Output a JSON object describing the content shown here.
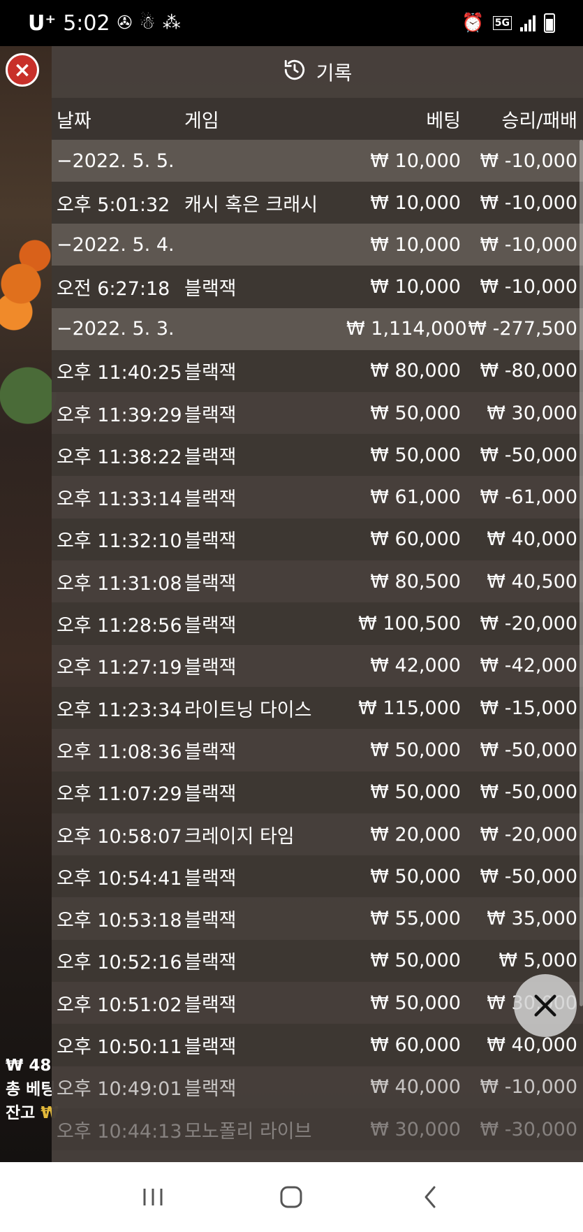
{
  "status_bar": {
    "carrier": "U⁺",
    "time": "5:02",
    "network": "5G"
  },
  "background": {
    "balance_line": "₩ 48",
    "total_bet_line": "총 베팅",
    "remain_line": "잔고 ",
    "remain_value": "₩"
  },
  "panel": {
    "title": "기록",
    "columns": {
      "date": "날짜",
      "game": "게임",
      "bet": "베팅",
      "winloss": "승리/패배"
    }
  },
  "rows": [
    {
      "type": "group",
      "date": "−2022. 5. 5.",
      "game": "",
      "bet": "₩ 10,000",
      "winloss": "₩ -10,000"
    },
    {
      "type": "item",
      "date": "오후 5:01:32",
      "game": "캐시 혹은 크래시",
      "bet": "₩ 10,000",
      "winloss": "₩ -10,000"
    },
    {
      "type": "group",
      "date": "−2022. 5. 4.",
      "game": "",
      "bet": "₩ 10,000",
      "winloss": "₩ -10,000"
    },
    {
      "type": "item",
      "date": "오전 6:27:18",
      "game": "블랙잭",
      "bet": "₩ 10,000",
      "winloss": "₩ -10,000"
    },
    {
      "type": "group",
      "date": "−2022. 5. 3.",
      "game": "",
      "bet": "₩ 1,114,000",
      "winloss": "₩ -277,500"
    },
    {
      "type": "item",
      "date": "오후 11:40:25",
      "game": "블랙잭",
      "bet": "₩ 80,000",
      "winloss": "₩ -80,000"
    },
    {
      "type": "item",
      "date": "오후 11:39:29",
      "game": "블랙잭",
      "bet": "₩ 50,000",
      "winloss": "₩ 30,000"
    },
    {
      "type": "item",
      "date": "오후 11:38:22",
      "game": "블랙잭",
      "bet": "₩ 50,000",
      "winloss": "₩ -50,000"
    },
    {
      "type": "item",
      "date": "오후 11:33:14",
      "game": "블랙잭",
      "bet": "₩ 61,000",
      "winloss": "₩ -61,000"
    },
    {
      "type": "item",
      "date": "오후 11:32:10",
      "game": "블랙잭",
      "bet": "₩ 60,000",
      "winloss": "₩ 40,000"
    },
    {
      "type": "item",
      "date": "오후 11:31:08",
      "game": "블랙잭",
      "bet": "₩ 80,500",
      "winloss": "₩ 40,500"
    },
    {
      "type": "item",
      "date": "오후 11:28:56",
      "game": "블랙잭",
      "bet": "₩ 100,500",
      "winloss": "₩ -20,000"
    },
    {
      "type": "item",
      "date": "오후 11:27:19",
      "game": "블랙잭",
      "bet": "₩ 42,000",
      "winloss": "₩ -42,000"
    },
    {
      "type": "item",
      "date": "오후 11:23:34",
      "game": "라이트닝 다이스",
      "bet": "₩ 115,000",
      "winloss": "₩ -15,000"
    },
    {
      "type": "item",
      "date": "오후 11:08:36",
      "game": "블랙잭",
      "bet": "₩ 50,000",
      "winloss": "₩ -50,000"
    },
    {
      "type": "item",
      "date": "오후 11:07:29",
      "game": "블랙잭",
      "bet": "₩ 50,000",
      "winloss": "₩ -50,000"
    },
    {
      "type": "item",
      "date": "오후 10:58:07",
      "game": "크레이지 타임",
      "bet": "₩ 20,000",
      "winloss": "₩ -20,000"
    },
    {
      "type": "item",
      "date": "오후 10:54:41",
      "game": "블랙잭",
      "bet": "₩ 50,000",
      "winloss": "₩ -50,000"
    },
    {
      "type": "item",
      "date": "오후 10:53:18",
      "game": "블랙잭",
      "bet": "₩ 55,000",
      "winloss": "₩ 35,000"
    },
    {
      "type": "item",
      "date": "오후 10:52:16",
      "game": "블랙잭",
      "bet": "₩ 50,000",
      "winloss": "₩ 5,000"
    },
    {
      "type": "item",
      "date": "오후 10:51:02",
      "game": "블랙잭",
      "bet": "₩ 50,000",
      "winloss": "₩ 30,000"
    },
    {
      "type": "item",
      "date": "오후 10:50:11",
      "game": "블랙잭",
      "bet": "₩ 60,000",
      "winloss": "₩ 40,000"
    },
    {
      "type": "item",
      "date": "오후 10:49:01",
      "game": "블랙잭",
      "bet": "₩ 40,000",
      "winloss": "₩ -10,000"
    },
    {
      "type": "item",
      "date": "오후 10:44:13",
      "game": "모노폴리 라이브",
      "bet": "₩ 30,000",
      "winloss": "₩ -30,000"
    }
  ],
  "icons": {
    "history": "history-clock-icon",
    "close": "close-icon",
    "exit": "exit-x-icon"
  },
  "colors": {
    "panel_bg": "#48413c",
    "group_row_bg": "#5e5751",
    "header_bg": "#3a3430",
    "close_red": "#c8302a",
    "balance_gold": "#e2b83a"
  }
}
